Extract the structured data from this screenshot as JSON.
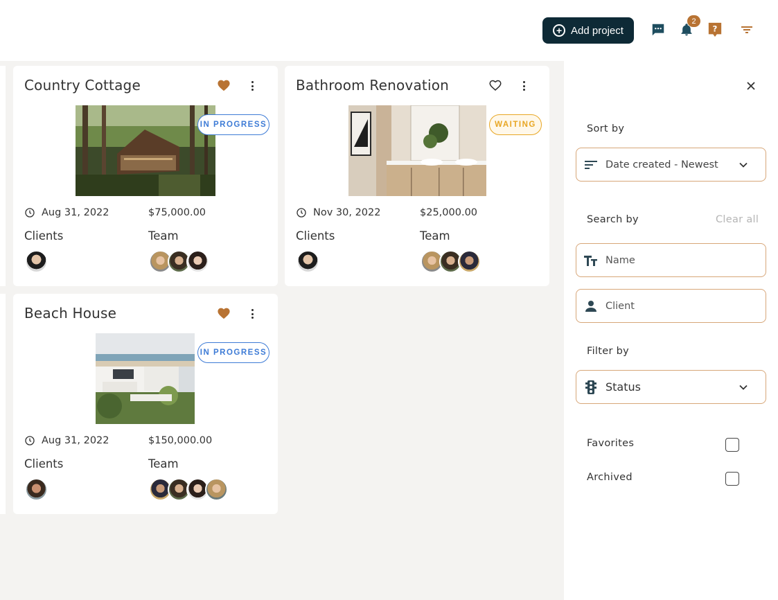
{
  "header": {
    "add_project_label": "Add project",
    "notifications_count": "2",
    "icons": [
      "chat-icon",
      "bell-icon",
      "help-icon",
      "filter-icon"
    ]
  },
  "projects": [
    {
      "title": "Country Cottage",
      "favorite": true,
      "status": "IN PROGRESS",
      "date": "Aug 31, 2022",
      "amount": "$75,000.00",
      "clients_label": "Clients",
      "team_label": "Team"
    },
    {
      "title": "Bathroom Renovation",
      "favorite": false,
      "status": "WAITING",
      "date": "Nov 30, 2022",
      "amount": "$25,000.00",
      "clients_label": "Clients",
      "team_label": "Team"
    },
    {
      "title": "Beach House",
      "favorite": true,
      "status": "IN PROGRESS",
      "date": "Aug 31, 2022",
      "amount": "$150,000.00",
      "clients_label": "Clients",
      "team_label": "Team"
    }
  ],
  "panel": {
    "sort_label": "Sort by",
    "sort_value": "Date created - Newest",
    "search_label": "Search by",
    "clear_all": "Clear all",
    "name_placeholder": "Name",
    "client_placeholder": "Client",
    "filter_label": "Filter by",
    "status_value": "Status",
    "favorites_label": "Favorites",
    "archived_label": "Archived",
    "favorites_checked": false,
    "archived_checked": false
  },
  "colors": {
    "accent": "#b87333",
    "dark": "#0e2a36",
    "in_progress": "#3d7bd6",
    "waiting": "#e8a623",
    "field_border": "#d7a678"
  }
}
